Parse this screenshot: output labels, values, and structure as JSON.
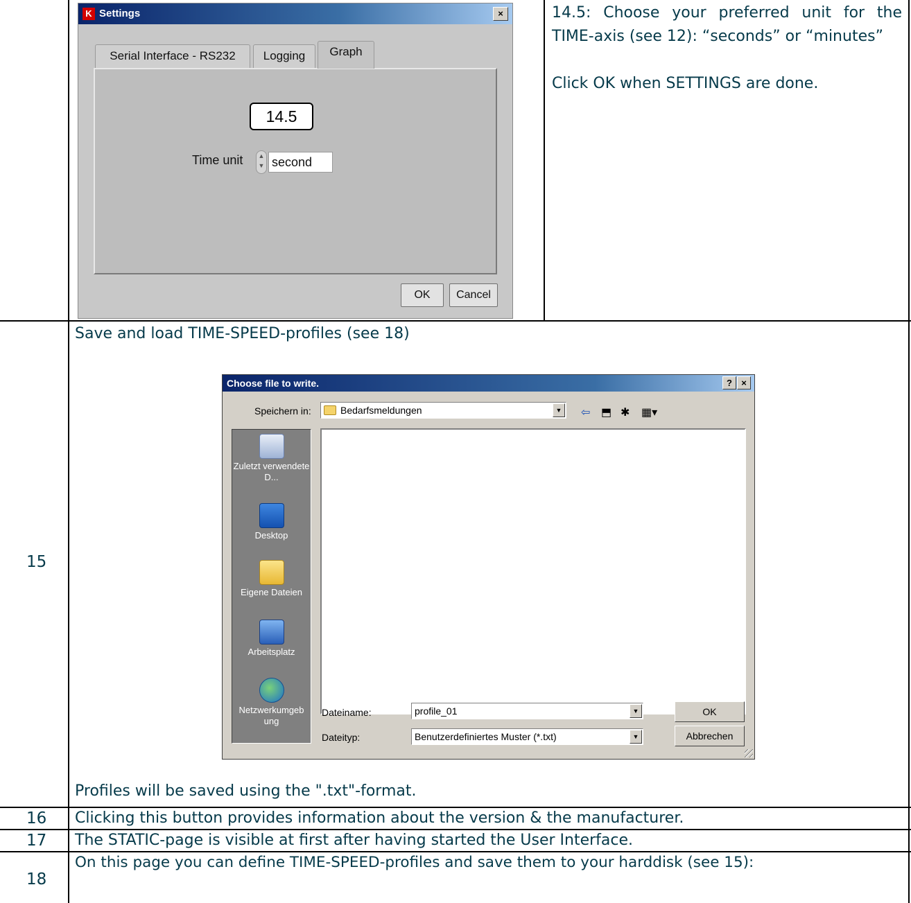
{
  "row14": {
    "settings_window": {
      "title": "Settings",
      "close_glyph": "×",
      "tabs": [
        "Serial Interface - RS232",
        "Logging",
        "Graph"
      ],
      "active_tab": "Graph",
      "callout": "14.5",
      "time_unit_label": "Time unit",
      "time_unit_value": "second",
      "ok_label": "OK",
      "cancel_label": "Cancel"
    },
    "description": {
      "line1": "14.5: Choose your preferred unit for the TIME-axis (see 12): “seconds” or “minutes”",
      "line2": "Click OK when SETTINGS are done."
    }
  },
  "row15": {
    "number": "15",
    "heading": "Save and load TIME-SPEED-profiles (see 18)",
    "footer": "Profiles will be saved using the \".txt\"-format.",
    "file_dialog": {
      "title": "Choose file to write.",
      "help_glyph": "?",
      "close_glyph": "×",
      "save_in_label": "Speichern in:",
      "save_in_value": "Bedarfsmeldungen",
      "places": [
        "Zuletzt verwendete D...",
        "Desktop",
        "Eigene Dateien",
        "Arbeitsplatz",
        "Netzwerkumgeb ung"
      ],
      "filename_label": "Dateiname:",
      "filename_value": "profile_01",
      "filetype_label": "Dateityp:",
      "filetype_value": "Benutzerdefiniertes Muster (*.txt)",
      "ok_label": "OK",
      "cancel_label": "Abbrechen"
    }
  },
  "row16": {
    "number": "16",
    "text": "Clicking this button provides information about the version & the manufacturer."
  },
  "row17": {
    "number": "17",
    "text": "The STATIC-page is visible at first after having started the User Interface."
  },
  "row18": {
    "number": "18",
    "text": "On this page you can define TIME-SPEED-profiles and save them to your harddisk (see 15):"
  }
}
